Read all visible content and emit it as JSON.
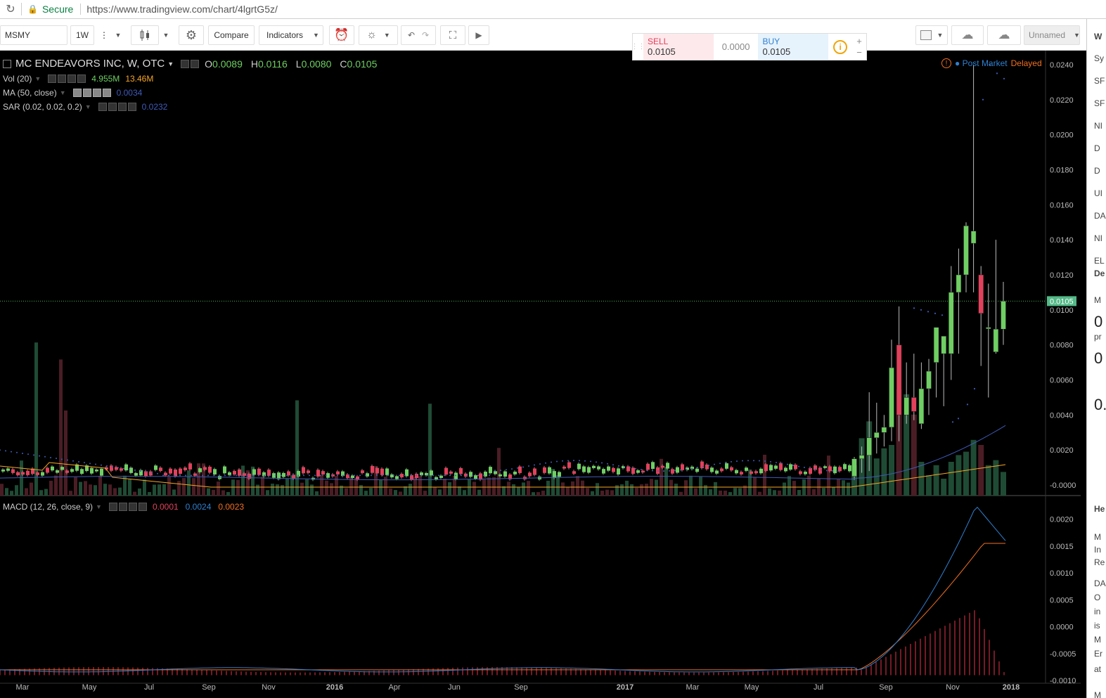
{
  "browser": {
    "secure_label": "Secure",
    "url": "https://www.tradingview.com/chart/4lgrtG5z/"
  },
  "toolbar": {
    "symbol": "MSMY",
    "interval": "1W",
    "compare": "Compare",
    "indicators": "Indicators",
    "layout_name": "Unnamed"
  },
  "trade": {
    "sell_label": "SELL",
    "sell_price": "0.0105",
    "spread": "0.0000",
    "buy_label": "BUY",
    "buy_price": "0.0105"
  },
  "status": {
    "post_market": "Post Market",
    "delayed": "Delayed"
  },
  "legend": {
    "title": "MC ENDEAVORS INC, W, OTC",
    "open": "0.0089",
    "high": "0.0116",
    "low": "0.0080",
    "close": "0.0105",
    "vol_label": "Vol (20)",
    "vol_value": "4.955M",
    "vol_ma": "13.46M",
    "ma_label": "MA (50, close)",
    "ma_value": "0.0034",
    "sar_label": "SAR (0.02, 0.02, 0.2)",
    "sar_value": "0.0232",
    "macd_label": "MACD (12, 26, close, 9)",
    "macd_hist": "0.0001",
    "macd_value": "0.0024",
    "macd_signal": "0.0023"
  },
  "sidebar_letters": [
    "W",
    "Sy",
    "SF",
    "SF",
    "NI",
    "D",
    "D",
    "UI",
    "DA",
    "NI",
    "EL",
    "De",
    "M",
    "0",
    "pr",
    "0",
    "0.",
    "He",
    "M",
    "In",
    "Re",
    "DA",
    "O",
    "in",
    "is",
    "M",
    "Er",
    "at",
    "M"
  ],
  "chart_data": {
    "type": "candlestick",
    "x_ticks": [
      "Mar",
      "May",
      "Jul",
      "Sep",
      "Nov",
      "2016",
      "Apr",
      "Jun",
      "Sep",
      "2017",
      "Mar",
      "May",
      "Jul",
      "Sep",
      "Nov",
      "2018"
    ],
    "price_axis": {
      "ticks": [
        "0.0240",
        "0.0220",
        "0.0200",
        "0.0180",
        "0.0160",
        "0.0140",
        "0.0120",
        "0.0100",
        "0.0080",
        "0.0060",
        "0.0040",
        "0.0020",
        "-0.0000"
      ],
      "ylim": [
        -0.0006,
        0.0248
      ],
      "last_price": "0.0105"
    },
    "macd_axis": {
      "ticks": [
        "0.0020",
        "0.0015",
        "0.0010",
        "0.0005",
        "0.0000",
        "-0.0005",
        "-0.0010"
      ],
      "ylim": [
        -0.00105,
        0.0024
      ]
    },
    "candles_recent": [
      {
        "o": 0.0005,
        "h": 0.0016,
        "l": 0.0003,
        "c": 0.0015
      },
      {
        "o": 0.0015,
        "h": 0.0022,
        "l": 0.0007,
        "c": 0.0017
      },
      {
        "o": 0.0017,
        "h": 0.0053,
        "l": 0.0008,
        "c": 0.0027
      },
      {
        "o": 0.0027,
        "h": 0.0047,
        "l": 0.0018,
        "c": 0.003
      },
      {
        "o": 0.003,
        "h": 0.004,
        "l": 0.0022,
        "c": 0.0033
      },
      {
        "o": 0.0033,
        "h": 0.0083,
        "l": 0.0025,
        "c": 0.0067
      },
      {
        "o": 0.008,
        "h": 0.0102,
        "l": 0.0025,
        "c": 0.004
      },
      {
        "o": 0.004,
        "h": 0.007,
        "l": 0.0035,
        "c": 0.005
      },
      {
        "o": 0.005,
        "h": 0.0075,
        "l": 0.0037,
        "c": 0.0042
      },
      {
        "o": 0.0035,
        "h": 0.007,
        "l": 0.0032,
        "c": 0.0055
      },
      {
        "o": 0.0055,
        "h": 0.0072,
        "l": 0.004,
        "c": 0.0065
      },
      {
        "o": 0.007,
        "h": 0.009,
        "l": 0.005,
        "c": 0.009
      },
      {
        "o": 0.0075,
        "h": 0.0085,
        "l": 0.0045,
        "c": 0.0085
      },
      {
        "o": 0.0075,
        "h": 0.0125,
        "l": 0.006,
        "c": 0.011
      },
      {
        "o": 0.011,
        "h": 0.0135,
        "l": 0.0075,
        "c": 0.012
      },
      {
        "o": 0.012,
        "h": 0.015,
        "l": 0.011,
        "c": 0.0148
      },
      {
        "o": 0.0138,
        "h": 0.024,
        "l": 0.011,
        "c": 0.0145
      },
      {
        "o": 0.012,
        "h": 0.0125,
        "l": 0.0068,
        "c": 0.0098
      },
      {
        "o": 0.009,
        "h": 0.0115,
        "l": 0.005,
        "c": 0.009
      },
      {
        "o": 0.0076,
        "h": 0.014,
        "l": 0.0075,
        "c": 0.0089
      },
      {
        "o": 0.0089,
        "h": 0.0116,
        "l": 0.008,
        "c": 0.0105
      }
    ],
    "volume_recent_fraction": [
      0.18,
      0.34,
      0.44,
      0.22,
      0.28,
      0.3,
      0.63,
      0.6,
      0.48,
      0.2,
      0.12,
      0.18,
      0.1,
      0.2,
      0.24,
      0.26,
      0.33,
      0.3,
      0.18,
      0.21,
      0.14
    ]
  }
}
